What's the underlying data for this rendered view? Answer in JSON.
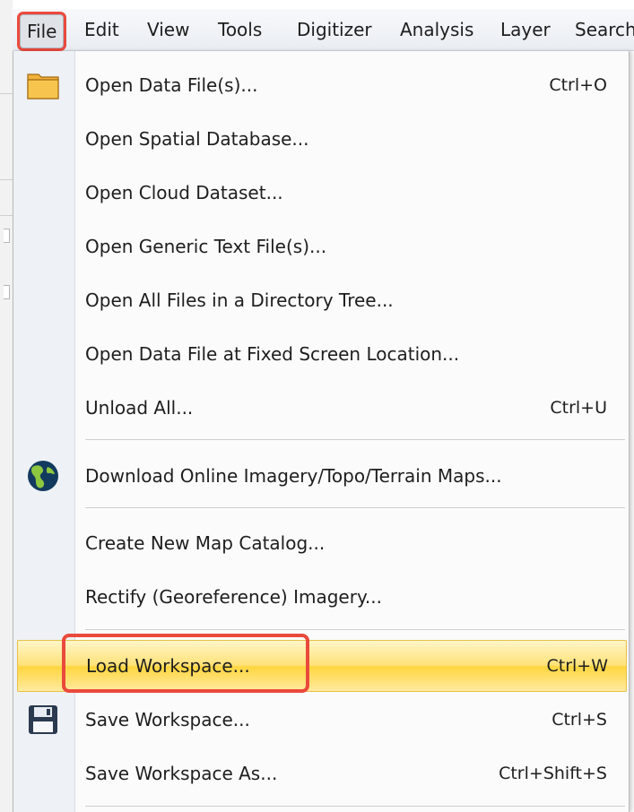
{
  "menubar": {
    "items": [
      "File",
      "Edit",
      "View",
      "Tools",
      "Digitizer",
      "Analysis",
      "Layer",
      "Search"
    ]
  },
  "file_menu": {
    "items": [
      {
        "label": "Open Data File(s)...",
        "shortcut": "Ctrl+O",
        "icon": "folder-icon"
      },
      {
        "label": "Open Spatial Database...",
        "shortcut": ""
      },
      {
        "label": "Open Cloud Dataset...",
        "shortcut": ""
      },
      {
        "label": "Open Generic Text File(s)...",
        "shortcut": ""
      },
      {
        "label": "Open All Files in a Directory Tree...",
        "shortcut": ""
      },
      {
        "label": "Open Data File at Fixed Screen Location...",
        "shortcut": ""
      },
      {
        "label": "Unload All...",
        "shortcut": "Ctrl+U"
      },
      {
        "label": "Download Online Imagery/Topo/Terrain Maps...",
        "shortcut": "",
        "icon": "globe-icon"
      },
      {
        "label": "Create New Map Catalog...",
        "shortcut": ""
      },
      {
        "label": "Rectify (Georeference) Imagery...",
        "shortcut": ""
      },
      {
        "label": "Load Workspace...",
        "shortcut": "Ctrl+W",
        "highlighted": true
      },
      {
        "label": "Save Workspace...",
        "shortcut": "Ctrl+S",
        "icon": "floppy-disk-icon"
      },
      {
        "label": "Save Workspace As...",
        "shortcut": "Ctrl+Shift+S"
      }
    ]
  },
  "colors": {
    "callout": "#ea4a3c",
    "highlight": "#ffd640",
    "gutter": "#eef1f5"
  }
}
